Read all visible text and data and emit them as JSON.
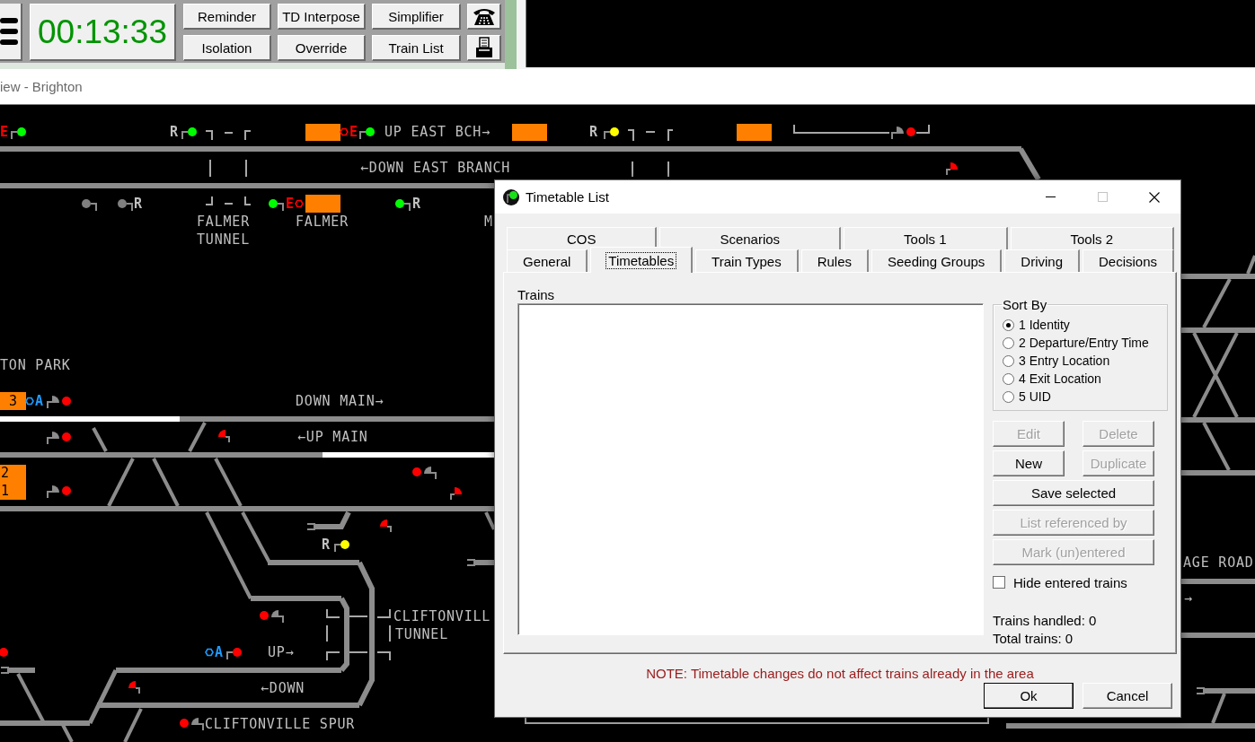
{
  "toolbar": {
    "clock": "00:13:33",
    "button_rows": [
      [
        "Reminder",
        "TD Interpose",
        "Simplifier"
      ],
      [
        "Isolation",
        "Override",
        "Train List"
      ]
    ]
  },
  "window_title": "iew - Brighton",
  "track_diagram": {
    "labels": [
      {
        "text": "E",
        "kind": "code",
        "color": "#ff0000",
        "ring": false
      },
      {
        "text": "R",
        "kind": "code",
        "color": "#c0c0c0",
        "ring": false
      },
      {
        "text": "E",
        "kind": "code",
        "color": "#ff0000",
        "ring": true
      },
      {
        "text": "UP EAST BCH→",
        "kind": "line"
      },
      {
        "text": "R",
        "kind": "code",
        "color": "#c0c0c0",
        "ring": false
      },
      {
        "text": "←DOWN EAST BRANCH",
        "kind": "line"
      },
      {
        "text": "R",
        "kind": "code",
        "color": "#c0c0c0",
        "ring": false
      },
      {
        "text": "E",
        "kind": "code",
        "color": "#ff0000",
        "ring": true
      },
      {
        "text": "R",
        "kind": "code",
        "color": "#c0c0c0",
        "ring": false
      },
      {
        "text": "FALMER",
        "kind": "place"
      },
      {
        "text": "TUNNEL",
        "kind": "place"
      },
      {
        "text": "FALMER",
        "kind": "place"
      },
      {
        "text": "M",
        "kind": "place"
      },
      {
        "text": "TON PARK",
        "kind": "place"
      },
      {
        "text": "A",
        "kind": "code",
        "color": "#1e9bff",
        "ring": true
      },
      {
        "text": "DOWN MAIN→",
        "kind": "line"
      },
      {
        "text": "←UP MAIN",
        "kind": "line"
      },
      {
        "text": "R",
        "kind": "code",
        "color": "#c0c0c0",
        "ring": false
      },
      {
        "text": "CLIFTONVILL",
        "kind": "place"
      },
      {
        "text": "TUNNEL",
        "kind": "place"
      },
      {
        "text": "A",
        "kind": "code",
        "color": "#1e9bff",
        "ring": true
      },
      {
        "text": "UP→",
        "kind": "line"
      },
      {
        "text": "←DOWN",
        "kind": "line"
      },
      {
        "text": "CLIFTONVILLE SPUR",
        "kind": "place"
      },
      {
        "text": "AGE ROAD",
        "kind": "place"
      },
      {
        "text": "→",
        "kind": "line"
      }
    ],
    "signals": [
      {
        "kind": "main",
        "color": "#00ff00"
      },
      {
        "kind": "main",
        "color": "#00ff00"
      },
      {
        "kind": "main",
        "color": "#00ff00"
      },
      {
        "kind": "main",
        "color": "#ffff00"
      },
      {
        "kind": "main-shunt",
        "color": "#ff0000"
      },
      {
        "kind": "shunt",
        "color": "#ff0000"
      },
      {
        "kind": "main",
        "color": "#808080"
      },
      {
        "kind": "main",
        "color": "#808080"
      },
      {
        "kind": "main",
        "color": "#00ff00"
      },
      {
        "kind": "main",
        "color": "#00ff00"
      },
      {
        "kind": "main-shunt",
        "color": "#ff0000"
      },
      {
        "kind": "main-shunt",
        "color": "#ff0000"
      },
      {
        "kind": "shunt",
        "color": "#ff0000"
      },
      {
        "kind": "main-shunt",
        "color": "#ff0000"
      },
      {
        "kind": "main-shunt",
        "color": "#ff0000"
      },
      {
        "kind": "shunt",
        "color": "#ff0000"
      },
      {
        "kind": "shunt",
        "color": "#ff0000"
      },
      {
        "kind": "main",
        "color": "#ffff00"
      },
      {
        "kind": "main-shunt",
        "color": "#ff0000"
      },
      {
        "kind": "main",
        "color": "#ff0000"
      },
      {
        "kind": "main",
        "color": "#ff0000"
      },
      {
        "kind": "shunt",
        "color": "#ff0000"
      },
      {
        "kind": "main-shunt",
        "color": "#ff0000"
      }
    ],
    "berths": [
      {
        "kind": "empty"
      },
      {
        "kind": "empty"
      },
      {
        "kind": "empty"
      },
      {
        "kind": "empty"
      },
      {
        "kind": "numbered",
        "lines": [
          "3"
        ]
      },
      {
        "kind": "numbered",
        "lines": [
          "2",
          "1"
        ]
      }
    ],
    "track_sections": [
      {
        "lit": true
      },
      {
        "lit": false
      },
      {
        "lit": false
      },
      {
        "lit": true
      }
    ]
  },
  "dialog": {
    "title": "Timetable List",
    "maximize_disabled": true,
    "tab_rows": [
      [
        {
          "label": "COS",
          "selected": false
        },
        {
          "label": "Scenarios",
          "selected": false
        },
        {
          "label": "Tools 1",
          "selected": false
        },
        {
          "label": "Tools 2",
          "selected": false
        }
      ],
      [
        {
          "label": "General",
          "selected": false
        },
        {
          "label": "Timetables",
          "selected": true
        },
        {
          "label": "Train Types",
          "selected": false
        },
        {
          "label": "Rules",
          "selected": false
        },
        {
          "label": "Seeding Groups",
          "selected": false
        },
        {
          "label": "Driving",
          "selected": false
        },
        {
          "label": "Decisions",
          "selected": false
        }
      ]
    ],
    "list_label": "Trains",
    "sort_by": {
      "title": "Sort By",
      "options": [
        {
          "label": "1 Identity",
          "selected": true
        },
        {
          "label": "2 Departure/Entry Time",
          "selected": false
        },
        {
          "label": "3 Entry Location",
          "selected": false
        },
        {
          "label": "4 Exit Location",
          "selected": false
        },
        {
          "label": "5 UID",
          "selected": false
        }
      ]
    },
    "buttons": [
      {
        "label": "Edit",
        "disabled": true
      },
      {
        "label": "Delete",
        "disabled": true
      },
      {
        "label": "New",
        "disabled": false
      },
      {
        "label": "Duplicate",
        "disabled": true
      },
      {
        "label": "Save selected",
        "disabled": false
      },
      {
        "label": "List referenced by",
        "disabled": true
      },
      {
        "label": "Mark (un)entered",
        "disabled": true
      }
    ],
    "hide_entered": {
      "label": "Hide entered trains",
      "checked": false
    },
    "counters": [
      "Trains handled: 0",
      "Total trains: 0"
    ],
    "note": "NOTE: Timetable changes do not affect trains already in the area",
    "footer_buttons": [
      {
        "label": "Ok",
        "default": true
      },
      {
        "label": "Cancel",
        "default": false
      }
    ]
  }
}
